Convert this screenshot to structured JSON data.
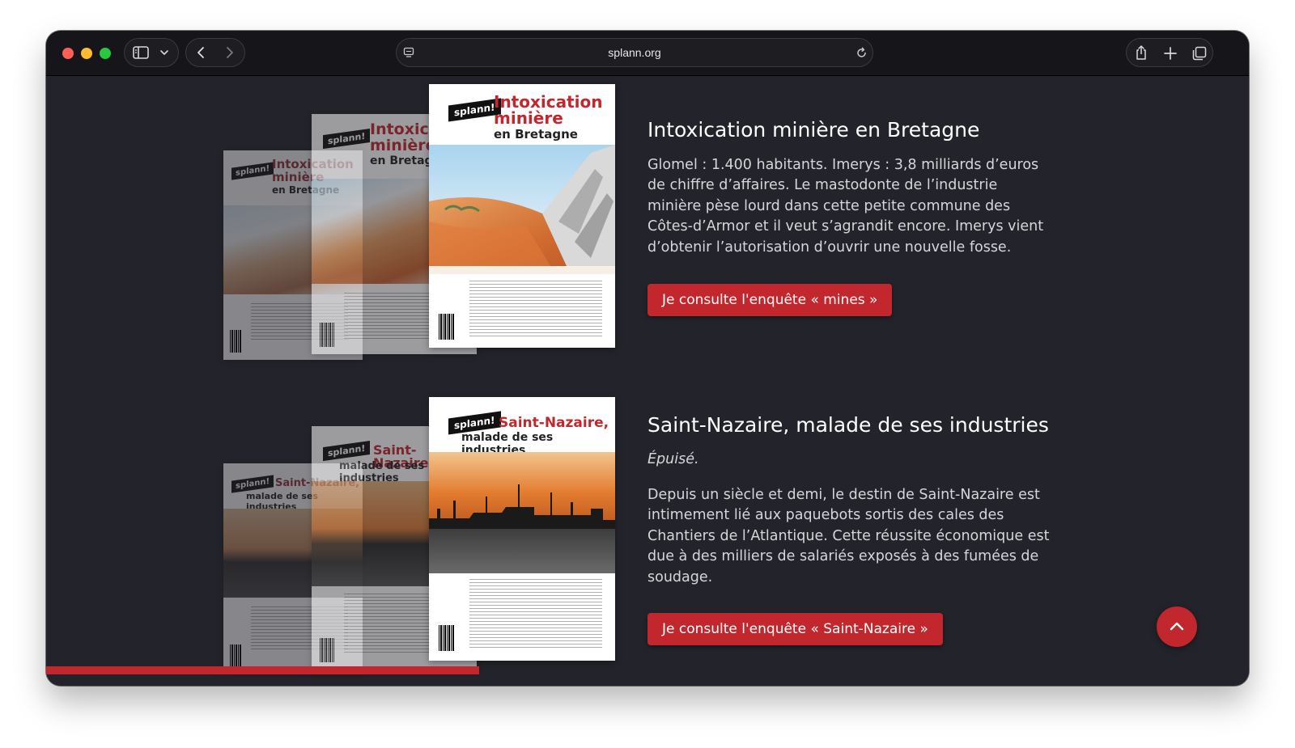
{
  "browser": {
    "url": "splann.org"
  },
  "articles": [
    {
      "title": "Intoxication minière en Bretagne",
      "body": "Glomel : 1.400 habitants. Imerys : 3,8 milliards d’euros de chiffre d’affaires. Le mastodonte de l’industrie minière pèse lourd dans cette petite commune des Côtes-d’Armor et il veut s’agrandit encore. Imerys vient d’obtenir l’autorisation d’ouvrir une nouvelle fosse.",
      "cta": "Je consulte l'enquête « mines »",
      "cover": {
        "brand": "splann!",
        "title_line1": "Intoxication",
        "title_line2": "minière",
        "subtitle": "en Bretagne"
      }
    },
    {
      "title": "Saint-Nazaire, malade de ses industries",
      "status": "Épuisé.",
      "body": "Depuis un siècle et demi, le destin de Saint-Nazaire est intimement lié aux paquebots sortis des cales des Chantiers de l’Atlantique. Cette réussite économique est due à des milliers de salariés exposés à des fumées de soudage.",
      "cta": "Je consulte l'enquête « Saint-Nazaire »",
      "cover": {
        "brand": "splann!",
        "title_line1": "Saint-Nazaire,",
        "subtitle": "malade de ses industries"
      }
    }
  ],
  "colors": {
    "accent": "#c1272d",
    "page_bg": "#23232b",
    "toolbar_bg": "#16161a"
  },
  "icons": [
    "sidebar-icon",
    "chevron-down-icon",
    "back-icon",
    "forward-icon",
    "page-icon",
    "reload-icon",
    "share-icon",
    "plus-icon",
    "tabs-icon",
    "chevron-up-icon"
  ]
}
